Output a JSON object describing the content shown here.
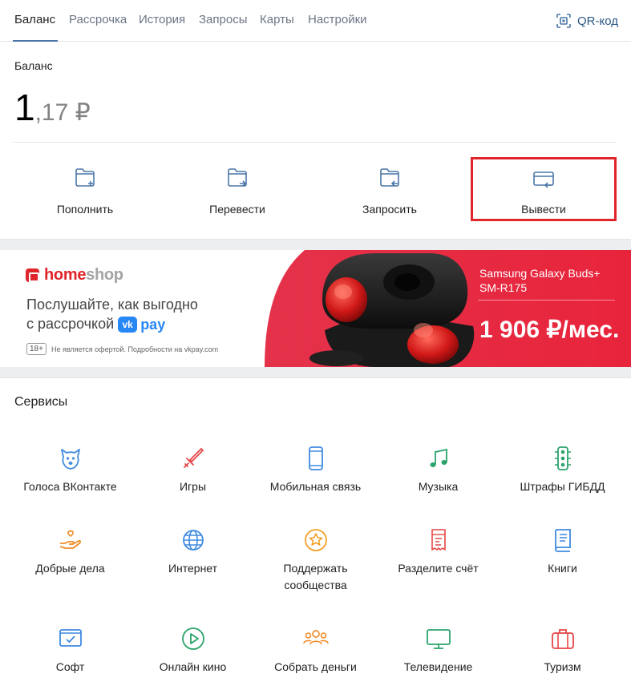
{
  "nav": {
    "tabs": [
      {
        "label": "Баланс"
      },
      {
        "label": "Рассрочка"
      },
      {
        "label": "История"
      },
      {
        "label": "Запросы"
      },
      {
        "label": "Карты"
      },
      {
        "label": "Настройки"
      }
    ],
    "active_tab": "Баланс",
    "qr_label": "QR-код"
  },
  "balance": {
    "label": "Баланс",
    "integer": "1",
    "fraction": ",17 ₽"
  },
  "actions": [
    {
      "label": "Пополнить",
      "icon": "wallet-add-icon"
    },
    {
      "label": "Перевести",
      "icon": "wallet-transfer-icon"
    },
    {
      "label": "Запросить",
      "icon": "wallet-request-icon"
    },
    {
      "label": "Вывести",
      "icon": "card-withdraw-icon",
      "highlighted": true
    }
  ],
  "banner": {
    "brand_home": "home",
    "brand_shop": "shop",
    "promo_line1": "Послушайте, как выгодно",
    "promo_line2": "с рассрочкой",
    "vk_mark": "vk",
    "vk_pay": "pay",
    "age": "18+",
    "disclaimer": "Не является офертой. Подробности на vkpay.com",
    "product_line1": "Samsung Galaxy Buds+",
    "product_line2": "SM-R175",
    "price": "1 906 ₽/мес.",
    "colors": {
      "accent_red": "#e0252b",
      "vk_blue": "#2787f5"
    }
  },
  "services": {
    "title": "Сервисы",
    "items": [
      {
        "label": "Голоса ВКонтакте",
        "icon": "vk-dog-icon"
      },
      {
        "label": "Игры",
        "icon": "sword-icon"
      },
      {
        "label": "Мобильная связь",
        "icon": "phone-icon"
      },
      {
        "label": "Музыка",
        "icon": "music-note-icon"
      },
      {
        "label": "Штрафы ГИБДД",
        "icon": "traffic-light-icon"
      },
      {
        "label": "Добрые дела",
        "icon": "hand-heart-icon"
      },
      {
        "label": "Интернет",
        "icon": "globe-icon"
      },
      {
        "label": "Поддержать сообщества",
        "icon": "star-circle-icon"
      },
      {
        "label": "Разделите счёт",
        "icon": "receipt-icon"
      },
      {
        "label": "Книги",
        "icon": "book-icon"
      },
      {
        "label": "Софт",
        "icon": "monitor-check-icon"
      },
      {
        "label": "Онлайн кино",
        "icon": "play-circle-icon"
      },
      {
        "label": "Собрать деньги",
        "icon": "people-icon"
      },
      {
        "label": "Телевидение",
        "icon": "tv-icon"
      },
      {
        "label": "Туризм",
        "icon": "suitcase-icon"
      }
    ]
  }
}
